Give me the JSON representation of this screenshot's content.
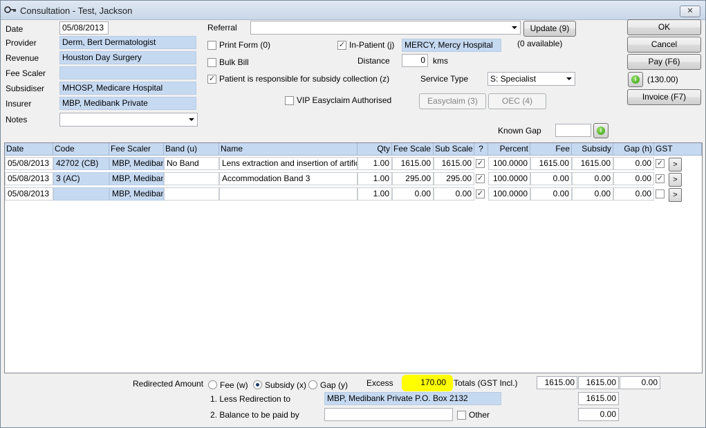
{
  "window": {
    "title": "Consultation - Test, Jackson",
    "close_label": "✕"
  },
  "form": {
    "date_label": "Date",
    "date_value": "05/08/2013",
    "provider_label": "Provider",
    "provider_value": "Derm, Bert  Dermatologist",
    "revenue_label": "Revenue",
    "revenue_value": "Houston Day Surgery",
    "fee_scaler_label": "Fee Scaler",
    "fee_scaler_value": "",
    "subsidiser_label": "Subsidiser",
    "subsidiser_value": "MHOSP, Medicare Hospital",
    "insurer_label": "Insurer",
    "insurer_value": "MBP, Medibank Private",
    "notes_label": "Notes",
    "notes_value": "",
    "referral_label": "Referral",
    "referral_value": "",
    "update_button": "Update (9)",
    "print_form_label": "Print Form (0)",
    "print_form_checked": false,
    "bulk_bill_label": "Bulk Bill",
    "bulk_bill_checked": false,
    "patient_responsible_label": "Patient is responsible for subsidy collection (z)",
    "patient_responsible_checked": true,
    "in_patient_label": "In-Patient (j)",
    "in_patient_checked": true,
    "hospital_value": "MERCY, Mercy Hospital",
    "available_text": "(0 available)",
    "distance_label": "Distance",
    "distance_value": "0",
    "distance_unit": "kms",
    "service_type_label": "Service Type",
    "service_type_value": "S: Specialist",
    "vip_label": "VIP Easyclaim Authorised",
    "vip_checked": false,
    "easyclaim_button": "Easyclaim (3)",
    "oec_button": "OEC (4)",
    "known_gap_label": "Known Gap",
    "known_gap_value": ""
  },
  "actions": {
    "ok": "OK",
    "cancel": "Cancel",
    "pay": "Pay (F6)",
    "pay_amount": "(130.00)",
    "invoice": "Invoice (F7)",
    "info_icon_glyph": "i"
  },
  "grid": {
    "headers": [
      "Date",
      "Code",
      "Fee Scaler",
      "Band (u)",
      "Name",
      "Qty",
      "Fee Scale",
      "Sub Scale",
      "?",
      "Percent",
      "Fee",
      "Subsidy",
      "Gap (h)",
      "GST"
    ],
    "rows": [
      {
        "date": "05/08/2013",
        "code": "42702 (CB)",
        "fee_scaler": "MBP, Medibank",
        "band": "No Band",
        "name": "Lens extraction and insertion of artificial le",
        "qty": "1.00",
        "fee_scale": "1615.00",
        "sub_scale": "1615.00",
        "q": true,
        "percent": "100.0000",
        "fee": "1615.00",
        "subsidy": "1615.00",
        "gap": "0.00",
        "gst": true,
        "go": ">"
      },
      {
        "date": "05/08/2013",
        "code": "3 (AC)",
        "fee_scaler": "MBP, Medibank",
        "band": "",
        "name": "Accommodation Band 3",
        "qty": "1.00",
        "fee_scale": "295.00",
        "sub_scale": "295.00",
        "q": true,
        "percent": "100.0000",
        "fee": "0.00",
        "subsidy": "0.00",
        "gap": "0.00",
        "gst": true,
        "go": ">"
      },
      {
        "date": "05/08/2013",
        "code": "",
        "fee_scaler": "MBP, Medibank",
        "band": "",
        "name": "",
        "qty": "1.00",
        "fee_scale": "0.00",
        "sub_scale": "0.00",
        "q": true,
        "percent": "100.0000",
        "fee": "0.00",
        "subsidy": "0.00",
        "gap": "0.00",
        "gst": false,
        "go": ">"
      }
    ]
  },
  "footer": {
    "redirected_label": "Redirected Amount",
    "fee_radio": "Fee (w)",
    "subsidy_radio": "Subsidy (x)",
    "gap_radio": "Gap (y)",
    "selected": "subsidy",
    "excess_label": "Excess",
    "excess_value": "170.00",
    "totals_label": "Totals (GST Incl.)",
    "total_fee": "1615.00",
    "total_subsidy": "1615.00",
    "total_gap": "0.00",
    "less_redirection_label": "1. Less Redirection to",
    "redirection_value": "MBP, Medibank Private P.O. Box 2132",
    "redirection_amount": "1615.00",
    "balance_label": "2. Balance to be paid by",
    "balance_value": "",
    "other_label": "Other",
    "other_checked": false,
    "balance_amount": "0.00",
    "highlight_color": "#ffff00"
  }
}
